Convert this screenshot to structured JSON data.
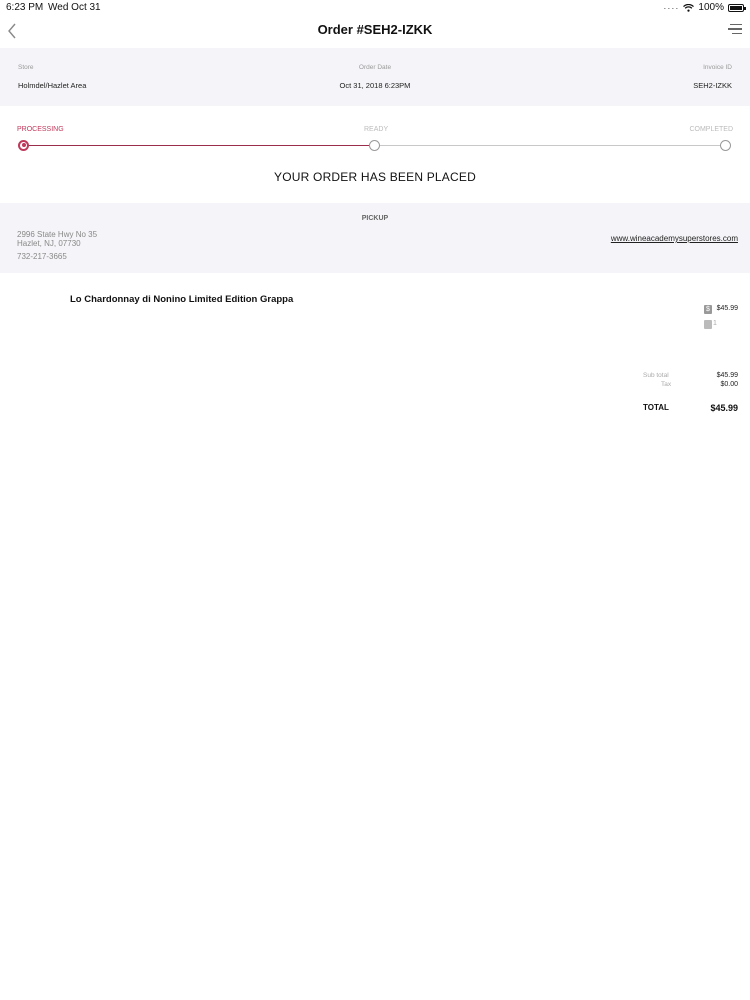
{
  "status_bar": {
    "time": "6:23 PM",
    "day": "Wed Oct 31",
    "battery": "100%"
  },
  "nav": {
    "title": "Order #SEH2-IZKK",
    "back_icon": "chevron-left-icon",
    "menu_icon": "hamburger-menu-icon"
  },
  "order_info": {
    "store_label": "Store",
    "store_value": "Holmdel/Hazlet Area",
    "date_label": "Order Date",
    "date_value": "Oct 31, 2018 6:23PM",
    "invoice_label": "Invoice ID",
    "invoice_value": "SEH2-IZKK"
  },
  "progress": {
    "steps": [
      "PROCESSING",
      "READY",
      "COMPLETED"
    ],
    "active_index": 0,
    "active_color": "#c0385b",
    "idle_color": "#bbbbbb"
  },
  "headline": "YOUR ORDER HAS BEEN PLACED",
  "pickup": {
    "title": "PICKUP",
    "address_line1": "2996 State Hwy No 35",
    "address_line2": "Hazlet, NJ, 07730",
    "phone": "732-217-3665",
    "website": "www.wineacademysuperstores.com"
  },
  "item": {
    "name": "Lo Chardonnay di Nonino Limited Edition Grappa",
    "price": "$45.99",
    "quantity": "1"
  },
  "totals": {
    "subtotal_label": "Sub total",
    "subtotal_value": "$45.99",
    "tax_label": "Tax",
    "tax_value": "$0.00",
    "total_label": "TOTAL",
    "total_value": "$45.99"
  }
}
